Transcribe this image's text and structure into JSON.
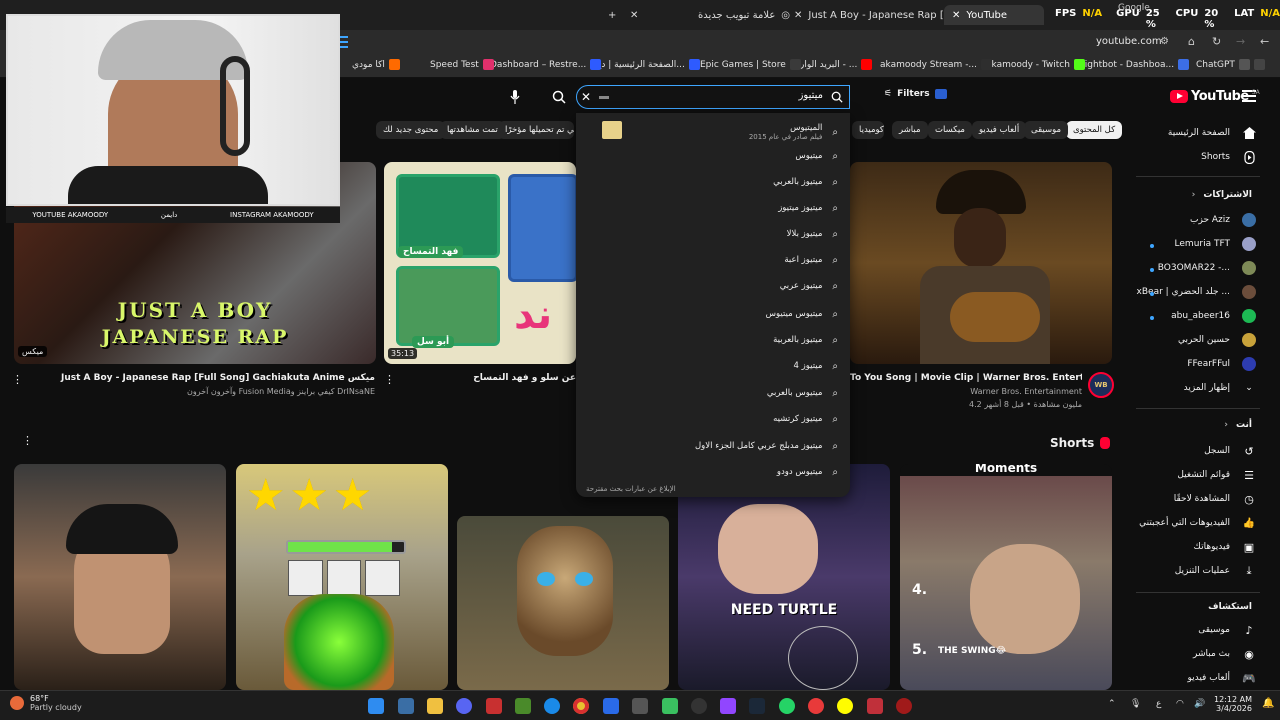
{
  "browser": {
    "tabs": [
      {
        "title": "علامة تبويب جديدة"
      },
      {
        "title": "Just A Boy - Japanese Rap [Full"
      },
      {
        "title": "YouTube"
      }
    ],
    "overlay": {
      "fps_label": "FPS",
      "fps_value": "N/A",
      "gpu_label": "GPU",
      "gpu_value": "25 %",
      "cpu_label": "CPU",
      "cpu_value": "20 %",
      "lat_label": "LAT",
      "lat_value": "N/A",
      "google_tab": "Google"
    },
    "address": "youtube.com",
    "bookmarks": [
      "akamoody - Twitch",
      "Nightbot - Dashboa...",
      "ChatGPT",
      "akamoody Stream -...",
      "البريد الوارد - ...",
      "Epic Games | Store",
      "الصفحة الرئيسية | دع...",
      "Dashboard – Restre...",
      "Speed Test",
      "اكا مودي"
    ]
  },
  "youtube": {
    "logo": "YouTube",
    "logo_sup": "SA",
    "search_value": "ميتيوز",
    "filters_label": "Filters",
    "chips": [
      "كل المحتوى",
      "موسيقى",
      "ألعاب فيديو",
      "ميكسات",
      "مباشر",
      "كوميديا",
      "مقاطع فيديو أضيف مؤخرًا",
      "تمت مشاهدتها",
      "محتوى جديد لك",
      "ات التي تم تحميلها مؤخرًا"
    ],
    "sidebar": {
      "main": [
        {
          "label": "الصفحة الرئيسية",
          "icon": "home-icon"
        },
        {
          "label": "Shorts",
          "icon": "shorts-icon"
        }
      ],
      "subs_heading": "الاشتراكات",
      "subs": [
        "حزب Aziz",
        "Lemuria TFT",
        "BO3OMAR22 -...",
        "xBear | جلد الحضري ...",
        "abu_abeer16",
        "حسين الحربي",
        "FFearFFul",
        "إظهار المزيد"
      ],
      "you_heading": "أنت",
      "you": [
        {
          "label": "السجل",
          "icon": "history-icon"
        },
        {
          "label": "قوائم التشغيل",
          "icon": "playlist-icon"
        },
        {
          "label": "المشاهدة لاحقًا",
          "icon": "clock-icon"
        },
        {
          "label": "الفيديوهات التي أعجبتني",
          "icon": "like-icon"
        },
        {
          "label": "فيديوهاتك",
          "icon": "video-icon"
        },
        {
          "label": "عمليات التنزيل",
          "icon": "download-icon"
        }
      ],
      "explore_heading": "استكشاف",
      "explore": [
        {
          "label": "موسيقى",
          "icon": "music-icon"
        },
        {
          "label": "بث مباشر",
          "icon": "live-icon"
        },
        {
          "label": "ألعاب فيديو",
          "icon": "game-icon"
        }
      ]
    },
    "videos": [
      {
        "title": "Just A Boy - Japanese Rap [Full Song] Gachiakuta Anime ميكس",
        "meta": "وآخرون آخرون Fusion Mediaكيفي براينز و DrINsaNE",
        "thumb_text_1": "JUST A BOY",
        "thumb_text_2": "JAPANESE RAP",
        "badge": "ميكس"
      },
      {
        "title": "عن سلو و فهد التمساح",
        "meta": "",
        "duration": "35:13",
        "name_tag_1": "فهد التمساح",
        "name_tag_2": "أبو سل"
      },
      {
        "title": "To You Song | Movie Clip | Warner Bros. Entertainment",
        "meta_channel": "Warner Bros. Entertainment",
        "meta_stats": "4.2 مليون مشاهدة • قبل 8 أشهر"
      }
    ],
    "shorts_heading": "Shorts",
    "shorts": [
      {
        "text": ""
      },
      {
        "text": ""
      },
      {
        "text": ""
      },
      {
        "text": "NEED TURTLE"
      },
      {
        "text": "Moments",
        "caption": "THE SWING😂"
      }
    ],
    "suggestions": [
      {
        "text": "الميتيوس",
        "sub": "فيلم صادر في عام 2015"
      },
      {
        "text": "ميتيوس"
      },
      {
        "text": "ميتيوز بالعربي"
      },
      {
        "text": "ميتيوز ميتيوز"
      },
      {
        "text": "ميتيوز بلالا"
      },
      {
        "text": "ميتيوز اعبة"
      },
      {
        "text": "ميتيوز عربي"
      },
      {
        "text": "ميتيوس ميتيوس"
      },
      {
        "text": "ميتيوز بالعربية"
      },
      {
        "text": "ميتيوز 4"
      },
      {
        "text": "ميتيوس بالعربي"
      },
      {
        "text": "ميتيوز كرتشيه"
      },
      {
        "text": "ميتيوز مدبلج عربي كامل الجزء الاول"
      },
      {
        "text": "ميتيوس دودو"
      }
    ],
    "report_text": "الإبلاغ عن عبارات بحث مقترحة"
  },
  "webcam": {
    "tag_1": "YOUTUBE AKAMOODY",
    "tag_2": "INSTAGRAM AKAMOODY",
    "tag_3": "دايمن"
  },
  "taskbar": {
    "weather_temp": "68°F",
    "weather_desc": "Partly cloudy",
    "time": "12:12 AM",
    "date": "3/4/2026",
    "lang": "ع"
  },
  "colors": {
    "accent": "#3ea6ff",
    "brand_red": "#ff0033",
    "bg": "#0f0f0f"
  }
}
